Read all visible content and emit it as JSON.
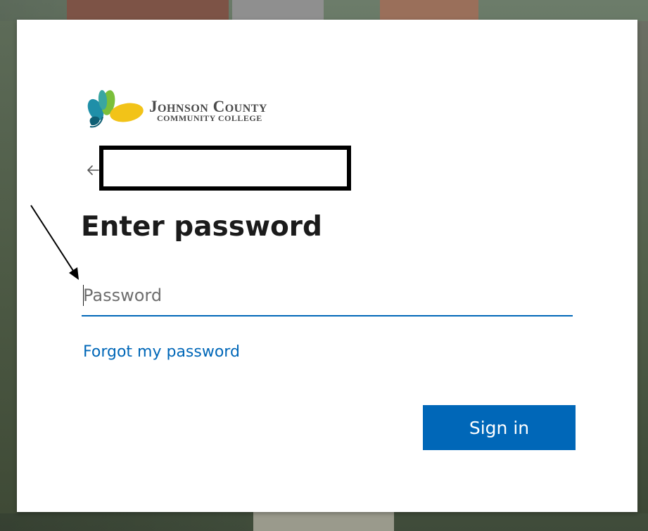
{
  "logo": {
    "line1": "Johnson County",
    "line2": "COMMUNITY COLLEGE"
  },
  "heading": {
    "title": "Enter password"
  },
  "password_field": {
    "placeholder": "Password",
    "value": ""
  },
  "links": {
    "forgot": "Forgot my password"
  },
  "buttons": {
    "sign_in": "Sign in"
  },
  "colors": {
    "accent": "#0067b8",
    "text": "#1b1b1b",
    "logo_teal": "#1f8fa8",
    "logo_green": "#7bbf3a",
    "logo_yellow": "#f2c318"
  },
  "icons": {
    "back": "back-arrow-icon",
    "annotation": "annotation-arrow-icon"
  }
}
